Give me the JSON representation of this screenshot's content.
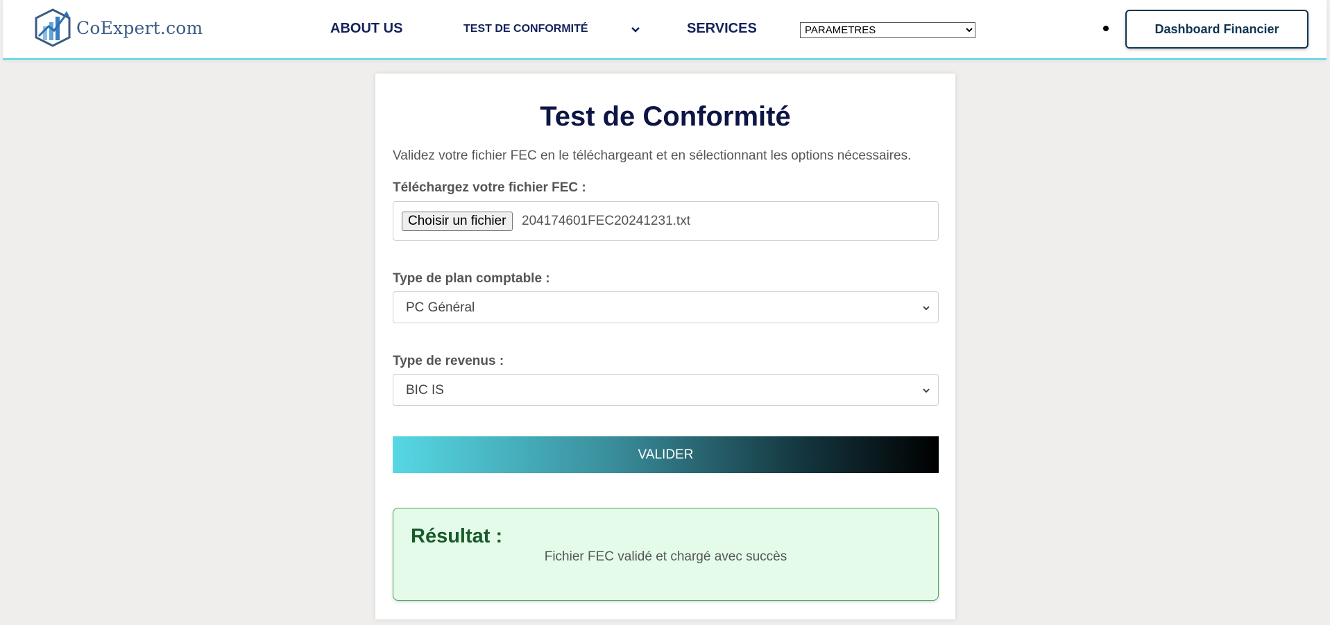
{
  "nav": {
    "logo_text": "CoExpert.com",
    "about": "ABOUT US",
    "test": "TEST DE CONFORMITÉ",
    "services": "SERVICES",
    "parametres_selected": "PARAMETRES",
    "dashboard": "Dashboard Financier"
  },
  "form": {
    "title": "Test de Conformité",
    "subtitle": "Validez votre fichier FEC en le téléchargeant et en sélectionnant les options nécessaires.",
    "file_label": "Téléchargez votre fichier FEC :",
    "file_button": "Choisir un fichier",
    "file_name": "204174601FEC20241231.txt",
    "plan_label": "Type de plan comptable :",
    "plan_value": "PC Général",
    "revenus_label": "Type de revenus :",
    "revenus_value": "BIC IS",
    "submit": "VALIDER"
  },
  "result": {
    "title": "Résultat :",
    "message": "Fichier FEC validé et chargé avec succès"
  },
  "colors": {
    "accent": "#4fd6e0",
    "navy": "#14215b",
    "success_bg": "#e3fbe8",
    "success_text": "#185a2a"
  }
}
